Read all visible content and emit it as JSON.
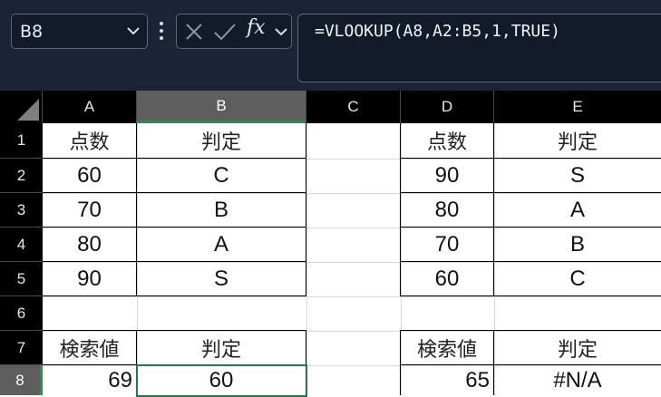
{
  "name_box": {
    "value": "B8"
  },
  "formula": {
    "text": "=VLOOKUP(A8,A2:B5,1,TRUE)",
    "fx_label": "fx"
  },
  "columns": [
    "A",
    "B",
    "C",
    "D",
    "E"
  ],
  "rows": [
    "1",
    "2",
    "3",
    "4",
    "5",
    "6",
    "7",
    "8"
  ],
  "cells": {
    "A1": "点数",
    "B1": "判定",
    "A2": "60",
    "B2": "C",
    "A3": "70",
    "B3": "B",
    "A4": "80",
    "B4": "A",
    "A5": "90",
    "B5": "S",
    "A7": "検索値",
    "B7": "判定",
    "A8": "69",
    "B8": "60",
    "D1": "点数",
    "E1": "判定",
    "D2": "90",
    "E2": "S",
    "D3": "80",
    "E3": "A",
    "D4": "70",
    "E4": "B",
    "D5": "60",
    "E5": "C",
    "D7": "検索値",
    "E7": "判定",
    "D8": "65",
    "E8": "#N/A"
  },
  "selection": {
    "cell": "B8",
    "accent": "#1f7a45"
  },
  "colors": {
    "topbar": "#1b2436",
    "header": "#000000",
    "selected_header": "#5e5e5e"
  }
}
